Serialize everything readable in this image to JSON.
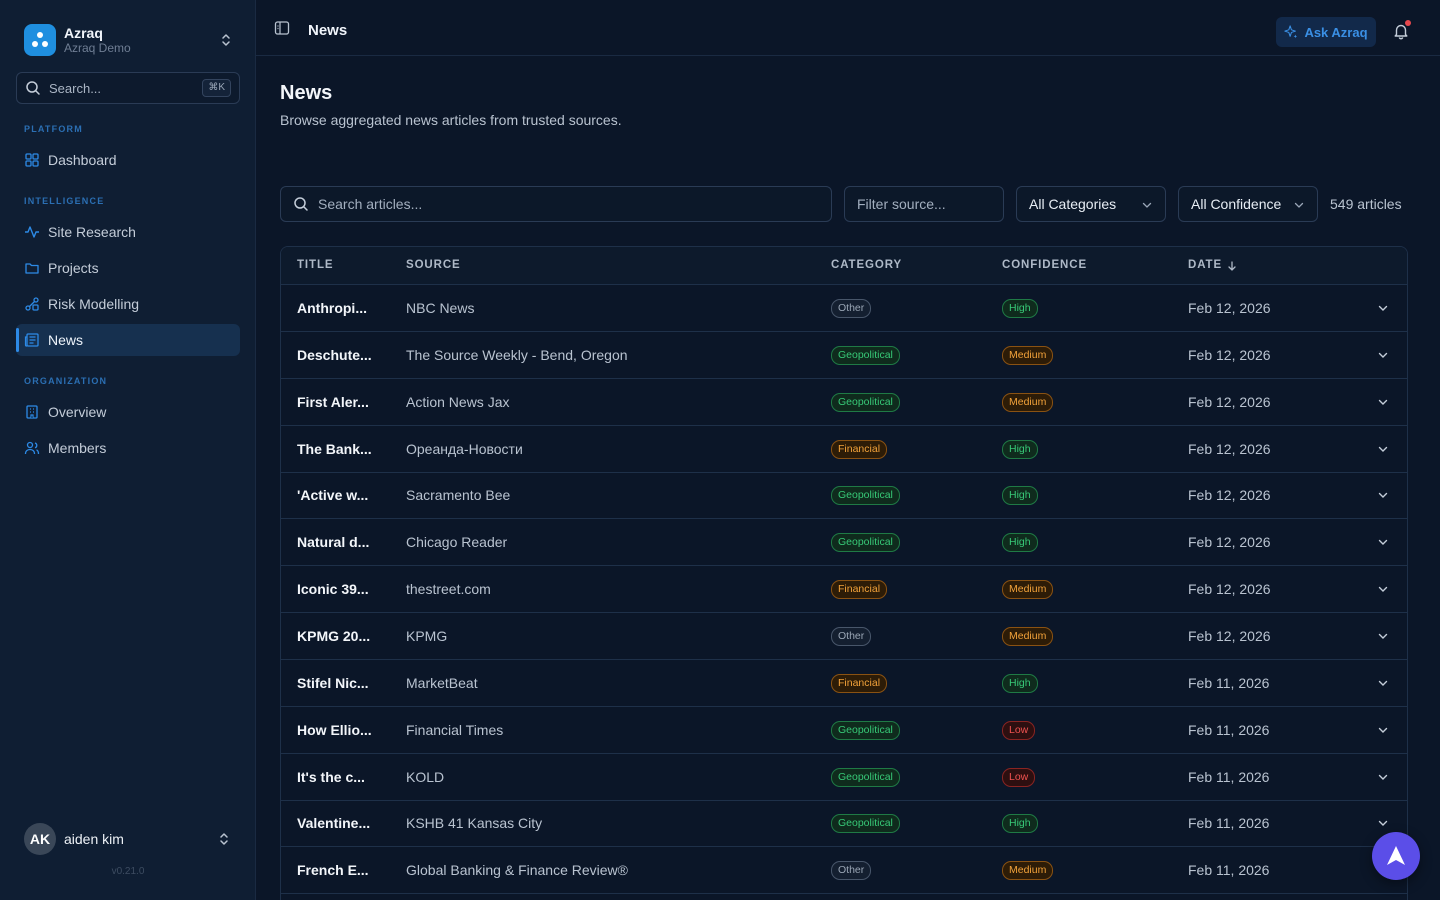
{
  "workspace": {
    "name": "Azraq",
    "subtitle": "Azraq Demo"
  },
  "sidebar": {
    "search_placeholder": "Search...",
    "search_shortcut": "⌘K",
    "sections": {
      "platform": "PLATFORM",
      "intelligence": "INTELLIGENCE",
      "organization": "ORGANIZATION"
    },
    "items": {
      "dashboard": "Dashboard",
      "site_research": "Site Research",
      "projects": "Projects",
      "risk_modelling": "Risk Modelling",
      "news": "News",
      "overview": "Overview",
      "members": "Members"
    },
    "active_item": "News",
    "user": {
      "initials": "AK",
      "name": "aiden kim"
    },
    "version": "v0.21.0"
  },
  "topbar": {
    "title": "News",
    "ask_button": "Ask Azraq",
    "notification_dot": true
  },
  "main": {
    "title": "News",
    "description": "Browse aggregated news articles from trusted sources.",
    "search_placeholder": "Search articles...",
    "source_placeholder": "Filter source...",
    "category_select": "All Categories",
    "confidence_select": "All Confidence",
    "article_count": "549 articles"
  },
  "table": {
    "headers": {
      "title": "TITLE",
      "source": "SOURCE",
      "category": "CATEGORY",
      "confidence": "CONFIDENCE",
      "date": "DATE"
    },
    "sort_column": "DATE",
    "rows": [
      {
        "title": "Anthropi...",
        "source": "NBC News",
        "category": "Other",
        "confidence": "High",
        "date": "Feb 12, 2026"
      },
      {
        "title": "Deschute...",
        "source": "The Source Weekly - Bend, Oregon",
        "category": "Geopolitical",
        "confidence": "Medium",
        "date": "Feb 12, 2026"
      },
      {
        "title": "First Aler...",
        "source": "Action News Jax",
        "category": "Geopolitical",
        "confidence": "Medium",
        "date": "Feb 12, 2026"
      },
      {
        "title": "The Bank...",
        "source": "Ореанда-Новости",
        "category": "Financial",
        "confidence": "High",
        "date": "Feb 12, 2026"
      },
      {
        "title": "'Active w...",
        "source": "Sacramento Bee",
        "category": "Geopolitical",
        "confidence": "High",
        "date": "Feb 12, 2026"
      },
      {
        "title": "Natural d...",
        "source": "Chicago Reader",
        "category": "Geopolitical",
        "confidence": "High",
        "date": "Feb 12, 2026"
      },
      {
        "title": "Iconic 39...",
        "source": "thestreet.com",
        "category": "Financial",
        "confidence": "Medium",
        "date": "Feb 12, 2026"
      },
      {
        "title": "KPMG 20...",
        "source": "KPMG",
        "category": "Other",
        "confidence": "Medium",
        "date": "Feb 12, 2026"
      },
      {
        "title": "Stifel Nic...",
        "source": "MarketBeat",
        "category": "Financial",
        "confidence": "High",
        "date": "Feb 11, 2026"
      },
      {
        "title": "How Ellio...",
        "source": "Financial Times",
        "category": "Geopolitical",
        "confidence": "Low",
        "date": "Feb 11, 2026"
      },
      {
        "title": "It's the c...",
        "source": "KOLD",
        "category": "Geopolitical",
        "confidence": "Low",
        "date": "Feb 11, 2026"
      },
      {
        "title": "Valentine...",
        "source": "KSHB 41 Kansas City",
        "category": "Geopolitical",
        "confidence": "High",
        "date": "Feb 11, 2026"
      },
      {
        "title": "French E...",
        "source": "Global Banking & Finance Review®",
        "category": "Other",
        "confidence": "Medium",
        "date": "Feb 11, 2026"
      }
    ]
  },
  "colors": {
    "accent": "#2d8ae6",
    "category": {
      "Other": "#9aa6b5",
      "Geopolitical": "#37c977",
      "Financial": "#f2a23a"
    },
    "confidence": {
      "High": "#37c977",
      "Medium": "#f2a23a",
      "Low": "#ef5350"
    },
    "fab": "#5b4ee8"
  }
}
